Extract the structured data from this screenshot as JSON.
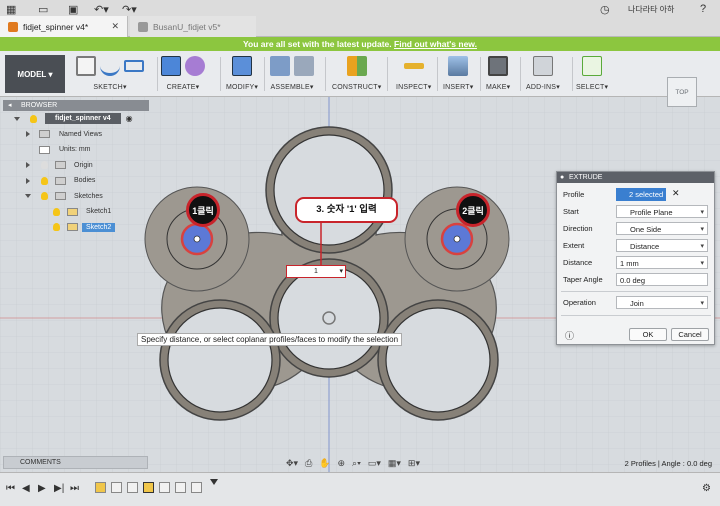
{
  "tabs": [
    {
      "label": "fidjet_spinner v4*"
    },
    {
      "label": "BusanU_fidjet v5*"
    }
  ],
  "user_name": "나다라타 아하",
  "banner": {
    "text": "You are all set with the latest update.",
    "link": "Find out what's new."
  },
  "ribbon": {
    "mode": "MODEL",
    "groups": [
      "SKETCH",
      "CREATE",
      "MODIFY",
      "ASSEMBLE",
      "CONSTRUCT",
      "INSPECT",
      "INSERT",
      "MAKE",
      "ADD-INS",
      "SELECT"
    ]
  },
  "browser": {
    "title": "BROWSER",
    "root": "fidjet_spinner v4",
    "items": [
      "Named Views",
      "Units: mm",
      "Origin",
      "Bodies",
      "Sketches",
      "Sketch1",
      "Sketch2"
    ]
  },
  "comments": "COMMENTS",
  "extrude": {
    "title": "EXTRUDE",
    "labels": {
      "profile": "Profile",
      "start": "Start",
      "direction": "Direction",
      "extent": "Extent",
      "distance": "Distance",
      "taper": "Taper Angle",
      "operation": "Operation"
    },
    "values": {
      "profile": "2 selected",
      "start": "Profile Plane",
      "direction": "One Side",
      "extent": "Distance",
      "distance": "1 mm",
      "taper": "0.0 deg",
      "operation": "Join"
    },
    "ok": "OK",
    "cancel": "Cancel"
  },
  "canvas": {
    "tooltip": "Specify distance, or select coplanar profiles/faces to modify the selection",
    "callout": "3. 숫자 '1' 입력",
    "dim_value": "1",
    "badge_left": "1클릭",
    "badge_right": "2클릭"
  },
  "viewcube": "TOP",
  "status": "2 Profiles | Angle : 0.0 deg",
  "colors": {
    "banner": "#8cc63f",
    "accent": "#c8242b",
    "selection": "#3a7fd0",
    "profile_fill": "#5c79d6"
  }
}
